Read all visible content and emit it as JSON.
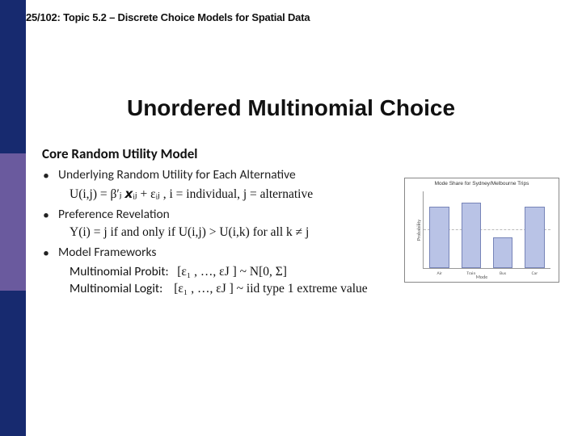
{
  "header": "25/102: Topic 5.2 – Discrete Choice Models for Spatial Data",
  "title": "Unordered Multinomial Choice",
  "section_head": "Core Random Utility Model",
  "bullets": {
    "b1": "Underlying Random Utility for Each Alternative",
    "b1_formula": "U(i,j) = β′ⱼ 𝙭ᵢⱼ + εᵢⱼ ,  i = individual, j = alternative",
    "b2": "Preference Revelation",
    "b2_formula": "Y(i) = j if and only if U(i,j) > U(i,k) for all k ≠ j",
    "b3": "Model Frameworks",
    "b3_line1_label": "Multinomial Probit:",
    "b3_line1_rhs": "[ε₁ , …, εJ ] ~ N[0, Σ]",
    "b3_line2_label": "Multinomial Logit:",
    "b3_line2_rhs": "[ε₁ , …, εJ ] ~ iid type 1 extreme value"
  },
  "chart_data": {
    "type": "bar",
    "title": "Mode Share for Sydney/Melbourne Trips",
    "xlabel": "Mode",
    "ylabel": "Probability",
    "ylim": [
      0,
      0.35
    ],
    "categories": [
      "Air",
      "Train",
      "Bus",
      "Car"
    ],
    "values": [
      0.28,
      0.3,
      0.14,
      0.28
    ],
    "bar_color": "#b9c3e6"
  }
}
